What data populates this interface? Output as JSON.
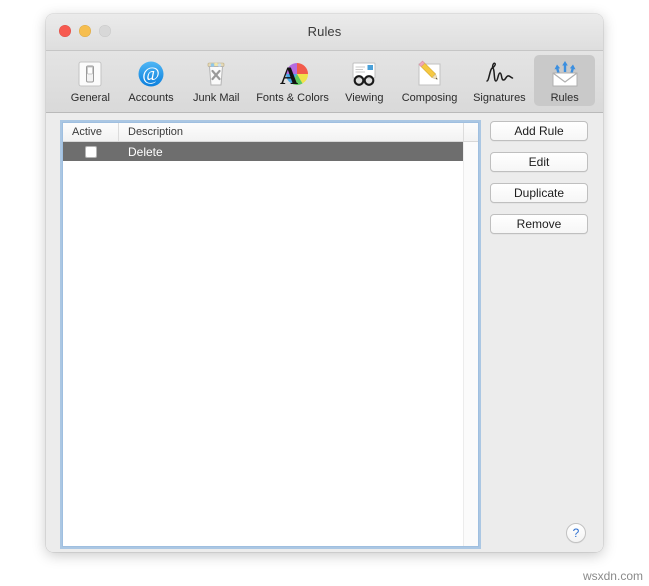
{
  "window": {
    "title": "Rules",
    "traffic_lights": [
      {
        "name": "close",
        "color": "#f75a50"
      },
      {
        "name": "minimize",
        "color": "#f6be4f"
      },
      {
        "name": "zoom",
        "color": "#d8d8d8"
      }
    ]
  },
  "toolbar": {
    "items": [
      {
        "label": "General",
        "icon": "switch-icon",
        "selected": false
      },
      {
        "label": "Accounts",
        "icon": "at-sign-icon",
        "selected": false
      },
      {
        "label": "Junk Mail",
        "icon": "trash-x-icon",
        "selected": false
      },
      {
        "label": "Fonts & Colors",
        "icon": "font-color-icon",
        "selected": false
      },
      {
        "label": "Viewing",
        "icon": "glasses-icon",
        "selected": false
      },
      {
        "label": "Composing",
        "icon": "pencil-icon",
        "selected": false
      },
      {
        "label": "Signatures",
        "icon": "signature-icon",
        "selected": false
      },
      {
        "label": "Rules",
        "icon": "rules-envelope-icon",
        "selected": true
      }
    ]
  },
  "table": {
    "columns": [
      "Active",
      "Description"
    ],
    "rows": [
      {
        "active": false,
        "description": "Delete",
        "selected": true
      }
    ]
  },
  "buttons": [
    {
      "label": "Add Rule",
      "name": "add-rule-button"
    },
    {
      "label": "Edit",
      "name": "edit-button"
    },
    {
      "label": "Duplicate",
      "name": "duplicate-button"
    },
    {
      "label": "Remove",
      "name": "remove-button"
    }
  ],
  "help": {
    "glyph": "?"
  },
  "watermark": {
    "text": "wsxdn.com"
  },
  "colors": {
    "selection_row": "#6e6e6e",
    "focus_ring": "#76a9dd",
    "help_glyph": "#2c6fd0",
    "toolbar_selected": "#c9c9c9"
  }
}
